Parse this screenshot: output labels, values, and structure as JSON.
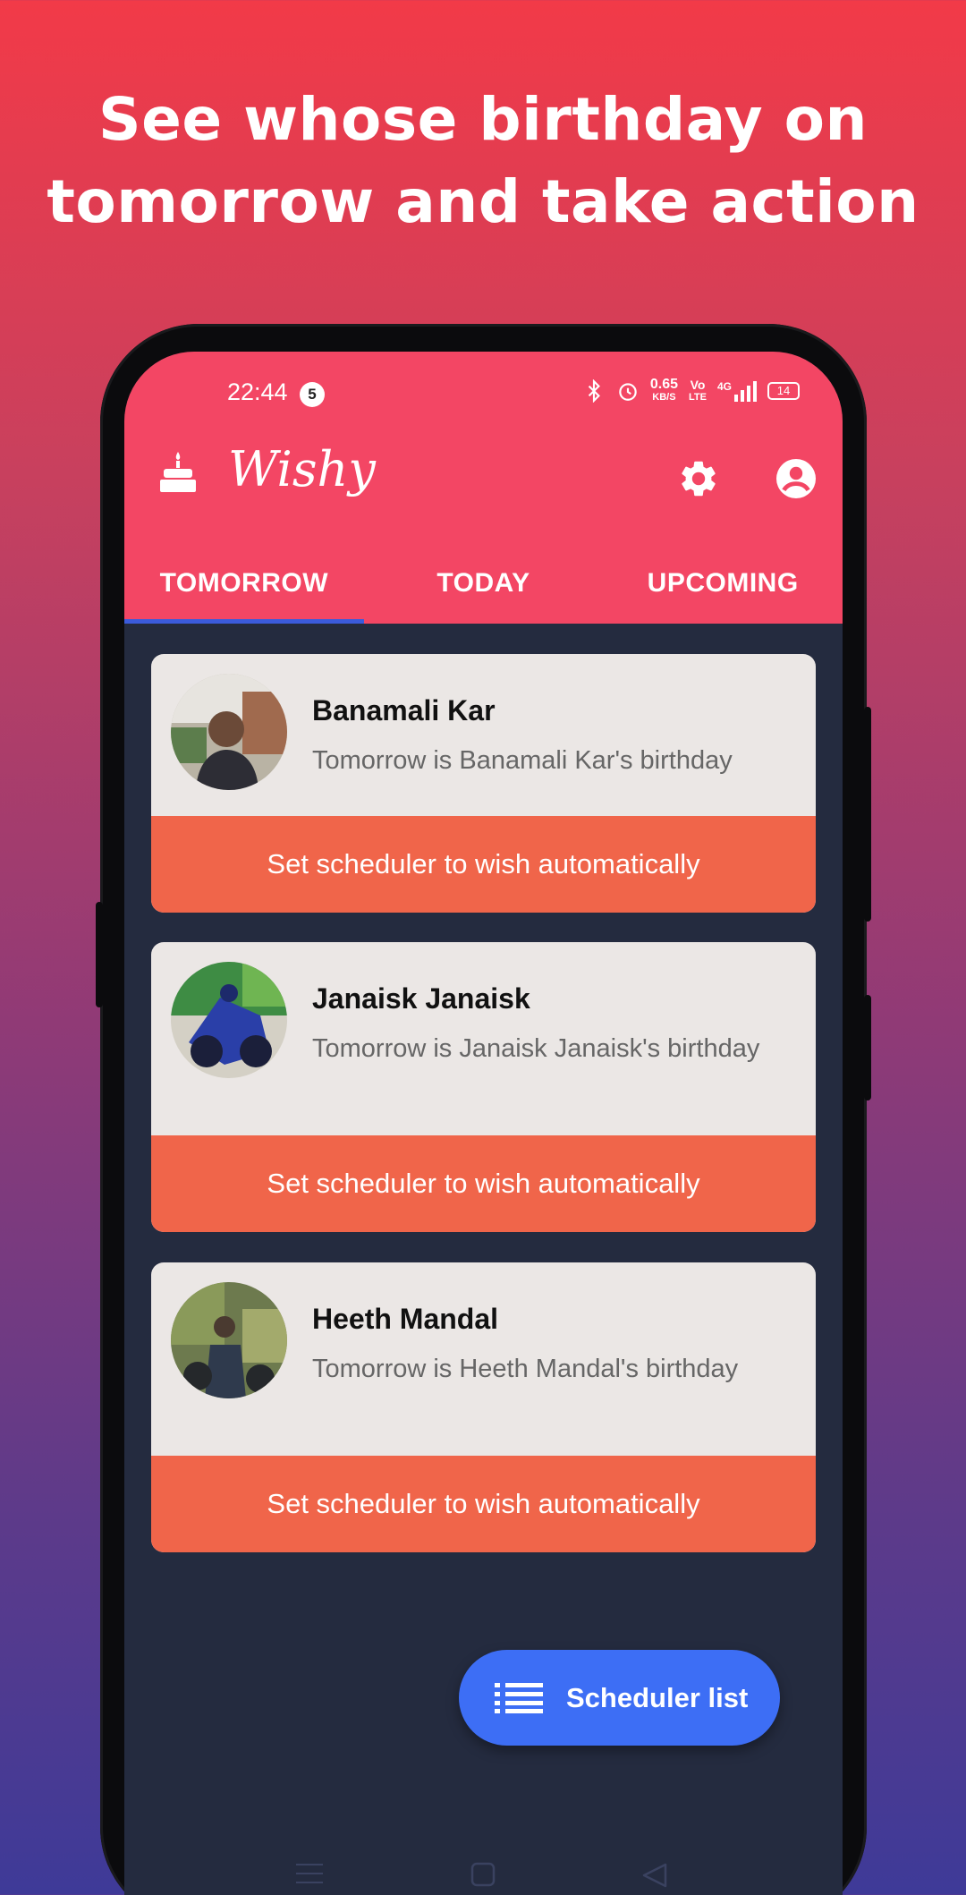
{
  "headline": {
    "line1": "See whose birthday on",
    "line2": "tomorrow and take action"
  },
  "status_bar": {
    "time": "22:44",
    "notification_count": "5",
    "speed_value": "0.65",
    "speed_unit": "KB/S",
    "volte_top": "Vo",
    "volte_bottom": "LTE",
    "network": "4G",
    "battery": "14"
  },
  "app_bar": {
    "title": "Wishy",
    "icons": [
      "cake-icon",
      "gear-icon",
      "account-icon"
    ]
  },
  "tabs": [
    {
      "label": "TOMORROW",
      "active": true
    },
    {
      "label": "TODAY",
      "active": false
    },
    {
      "label": "UPCOMING",
      "active": false
    }
  ],
  "cards": [
    {
      "name": "Banamali Kar",
      "description": "Tomorrow is Banamali Kar's birthday",
      "action": "Set scheduler to wish automatically"
    },
    {
      "name": "Janaisk Janaisk",
      "description": "Tomorrow is Janaisk Janaisk's birthday",
      "action": "Set scheduler to wish automatically"
    },
    {
      "name": "Heeth Mandal",
      "description": "Tomorrow is Heeth Mandal's birthday",
      "action": "Set scheduler to wish automatically"
    }
  ],
  "fab": {
    "label": "Scheduler list",
    "icon": "list-icon"
  },
  "nav_bar": {
    "icons": [
      "menu-icon",
      "home-square-icon",
      "back-triangle-icon"
    ]
  },
  "colors": {
    "app_bar": "#f34664",
    "tab_indicator": "#3b5bdb",
    "card_action": "#f0654a",
    "fab": "#3d6ef5",
    "screen_bg": "#242b3f"
  }
}
